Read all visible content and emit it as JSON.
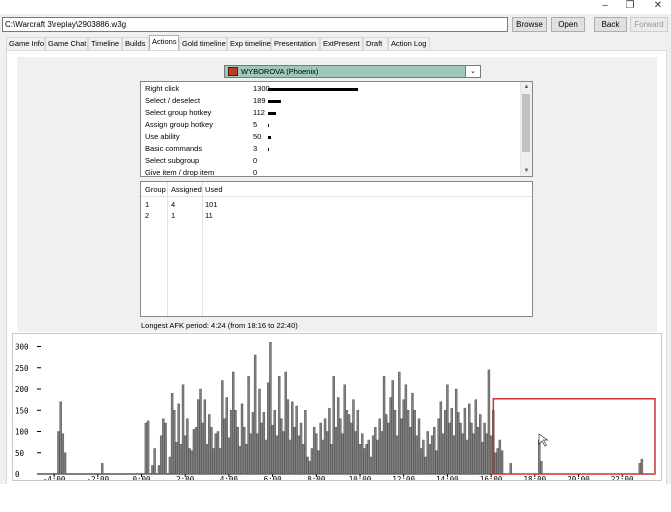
{
  "window": {
    "minimize_glyph": "–",
    "maximize_glyph": "❐",
    "close_glyph": "✕"
  },
  "toolbar": {
    "path": "C:\\Warcraft 3\\replay\\2903886.w3g",
    "browse": "Browse",
    "open": "Open",
    "back": "Back",
    "forward": "Forward"
  },
  "tabs": [
    {
      "label": "Game Info"
    },
    {
      "label": "Game Chat"
    },
    {
      "label": "Timeline"
    },
    {
      "label": "Builds"
    },
    {
      "label": "Actions",
      "active": true
    },
    {
      "label": "Gold timeline"
    },
    {
      "label": "Exp timeline"
    },
    {
      "label": "Presentation"
    },
    {
      "label": "ExtPresent"
    },
    {
      "label": "Draft"
    },
    {
      "label": "Action Log"
    }
  ],
  "player": {
    "name": "WYBOROVA (Phoenix)",
    "color": "#9ec8b8"
  },
  "actions": [
    {
      "label": "Right click",
      "count": "1300",
      "value": 1300
    },
    {
      "label": "Select / deselect",
      "count": "189",
      "value": 189
    },
    {
      "label": "Select group hotkey",
      "count": "112",
      "value": 112
    },
    {
      "label": "Assign group hotkey",
      "count": "5",
      "value": 5
    },
    {
      "label": "Use ability",
      "count": "50",
      "value": 50
    },
    {
      "label": "Basic commands",
      "count": "3",
      "value": 3
    },
    {
      "label": "Select subgroup",
      "count": "0",
      "value": 0
    },
    {
      "label": "Give item / drop item",
      "count": "0",
      "value": 0
    }
  ],
  "groups": {
    "headers": [
      "Group",
      "Assigned",
      "Used"
    ],
    "rows": [
      [
        "1",
        "4",
        "101"
      ],
      [
        "2",
        "1",
        "11"
      ]
    ]
  },
  "afk_text": "Longest AFK period: 4:24 (from 18:16 to 22:40)",
  "chart_data": {
    "type": "bar",
    "title": "",
    "xlabel": "",
    "ylabel": "",
    "ylim": [
      0,
      320
    ],
    "yticks": [
      "0",
      "50",
      "100",
      "150",
      "200",
      "250",
      "300"
    ],
    "xticks": [
      "-4:00",
      "-2:00",
      "0:00",
      "2:00",
      "4:00",
      "6:00",
      "8:00",
      "10:00",
      "12:00",
      "14:00",
      "16:00",
      "18:00",
      "20:00",
      "22:00"
    ],
    "x_unit": "minutes",
    "xlim": [
      -4.6,
      23.5
    ],
    "highlight": {
      "x_from": 16.1,
      "x_to": 23.5,
      "y_from": 0,
      "y_to": 177,
      "color": "#cc3333"
    },
    "bar_color": "#808080",
    "points": [
      [
        -3.8,
        100
      ],
      [
        -3.7,
        170
      ],
      [
        -3.6,
        95
      ],
      [
        -3.5,
        50
      ],
      [
        -1.8,
        25
      ],
      [
        0.2,
        120
      ],
      [
        0.3,
        125
      ],
      [
        0.5,
        20
      ],
      [
        0.6,
        60
      ],
      [
        0.8,
        20
      ],
      [
        0.9,
        90
      ],
      [
        1.0,
        130
      ],
      [
        1.1,
        120
      ],
      [
        1.3,
        40
      ],
      [
        1.4,
        190
      ],
      [
        1.5,
        150
      ],
      [
        1.6,
        75
      ],
      [
        1.7,
        165
      ],
      [
        1.8,
        70
      ],
      [
        1.9,
        210
      ],
      [
        2.0,
        90
      ],
      [
        2.1,
        130
      ],
      [
        2.2,
        60
      ],
      [
        2.3,
        55
      ],
      [
        2.4,
        105
      ],
      [
        2.5,
        110
      ],
      [
        2.6,
        175
      ],
      [
        2.7,
        200
      ],
      [
        2.8,
        120
      ],
      [
        2.9,
        175
      ],
      [
        3.0,
        70
      ],
      [
        3.1,
        140
      ],
      [
        3.2,
        110
      ],
      [
        3.3,
        60
      ],
      [
        3.4,
        95
      ],
      [
        3.5,
        100
      ],
      [
        3.6,
        60
      ],
      [
        3.7,
        220
      ],
      [
        3.8,
        130
      ],
      [
        3.9,
        180
      ],
      [
        4.0,
        85
      ],
      [
        4.1,
        150
      ],
      [
        4.2,
        240
      ],
      [
        4.3,
        150
      ],
      [
        4.4,
        110
      ],
      [
        4.5,
        65
      ],
      [
        4.6,
        165
      ],
      [
        4.7,
        110
      ],
      [
        4.8,
        70
      ],
      [
        4.9,
        230
      ],
      [
        5.0,
        95
      ],
      [
        5.1,
        145
      ],
      [
        5.2,
        280
      ],
      [
        5.3,
        95
      ],
      [
        5.4,
        200
      ],
      [
        5.5,
        120
      ],
      [
        5.6,
        145
      ],
      [
        5.7,
        80
      ],
      [
        5.8,
        215
      ],
      [
        5.9,
        310
      ],
      [
        6.0,
        115
      ],
      [
        6.1,
        150
      ],
      [
        6.2,
        90
      ],
      [
        6.3,
        230
      ],
      [
        6.4,
        130
      ],
      [
        6.5,
        100
      ],
      [
        6.6,
        240
      ],
      [
        6.7,
        175
      ],
      [
        6.8,
        80
      ],
      [
        6.9,
        170
      ],
      [
        7.0,
        110
      ],
      [
        7.1,
        160
      ],
      [
        7.2,
        90
      ],
      [
        7.3,
        120
      ],
      [
        7.4,
        70
      ],
      [
        7.5,
        150
      ],
      [
        7.6,
        40
      ],
      [
        7.7,
        30
      ],
      [
        7.8,
        60
      ],
      [
        7.9,
        110
      ],
      [
        8.0,
        95
      ],
      [
        8.1,
        55
      ],
      [
        8.2,
        120
      ],
      [
        8.3,
        80
      ],
      [
        8.4,
        130
      ],
      [
        8.5,
        100
      ],
      [
        8.6,
        155
      ],
      [
        8.7,
        70
      ],
      [
        8.8,
        230
      ],
      [
        8.9,
        110
      ],
      [
        9.0,
        180
      ],
      [
        9.1,
        130
      ],
      [
        9.2,
        95
      ],
      [
        9.3,
        210
      ],
      [
        9.4,
        150
      ],
      [
        9.5,
        140
      ],
      [
        9.6,
        120
      ],
      [
        9.7,
        175
      ],
      [
        9.8,
        100
      ],
      [
        9.9,
        150
      ],
      [
        10.0,
        70
      ],
      [
        10.1,
        95
      ],
      [
        10.2,
        60
      ],
      [
        10.3,
        70
      ],
      [
        10.4,
        80
      ],
      [
        10.5,
        40
      ],
      [
        10.6,
        90
      ],
      [
        10.7,
        110
      ],
      [
        10.8,
        80
      ],
      [
        10.9,
        130
      ],
      [
        11.0,
        100
      ],
      [
        11.1,
        230
      ],
      [
        11.2,
        140
      ],
      [
        11.3,
        120
      ],
      [
        11.4,
        180
      ],
      [
        11.5,
        220
      ],
      [
        11.6,
        150
      ],
      [
        11.7,
        90
      ],
      [
        11.8,
        240
      ],
      [
        11.9,
        130
      ],
      [
        12.0,
        175
      ],
      [
        12.1,
        210
      ],
      [
        12.2,
        150
      ],
      [
        12.3,
        110
      ],
      [
        12.4,
        190
      ],
      [
        12.5,
        150
      ],
      [
        12.6,
        90
      ],
      [
        12.7,
        130
      ],
      [
        12.8,
        60
      ],
      [
        12.9,
        80
      ],
      [
        13.0,
        40
      ],
      [
        13.1,
        100
      ],
      [
        13.2,
        70
      ],
      [
        13.3,
        90
      ],
      [
        13.4,
        110
      ],
      [
        13.5,
        55
      ],
      [
        13.6,
        130
      ],
      [
        13.7,
        170
      ],
      [
        13.8,
        95
      ],
      [
        13.9,
        150
      ],
      [
        14.0,
        210
      ],
      [
        14.1,
        120
      ],
      [
        14.2,
        155
      ],
      [
        14.3,
        90
      ],
      [
        14.4,
        200
      ],
      [
        14.5,
        145
      ],
      [
        14.6,
        120
      ],
      [
        14.7,
        95
      ],
      [
        14.8,
        155
      ],
      [
        14.9,
        80
      ],
      [
        15.0,
        165
      ],
      [
        15.1,
        120
      ],
      [
        15.2,
        95
      ],
      [
        15.3,
        175
      ],
      [
        15.4,
        110
      ],
      [
        15.5,
        140
      ],
      [
        15.6,
        75
      ],
      [
        15.7,
        120
      ],
      [
        15.8,
        95
      ],
      [
        15.9,
        245
      ],
      [
        16.0,
        90
      ],
      [
        16.1,
        150
      ],
      [
        16.2,
        50
      ],
      [
        16.3,
        60
      ],
      [
        16.4,
        80
      ],
      [
        16.5,
        55
      ],
      [
        16.9,
        25
      ],
      [
        18.2,
        80
      ],
      [
        18.3,
        30
      ],
      [
        22.8,
        25
      ],
      [
        22.9,
        35
      ]
    ]
  }
}
